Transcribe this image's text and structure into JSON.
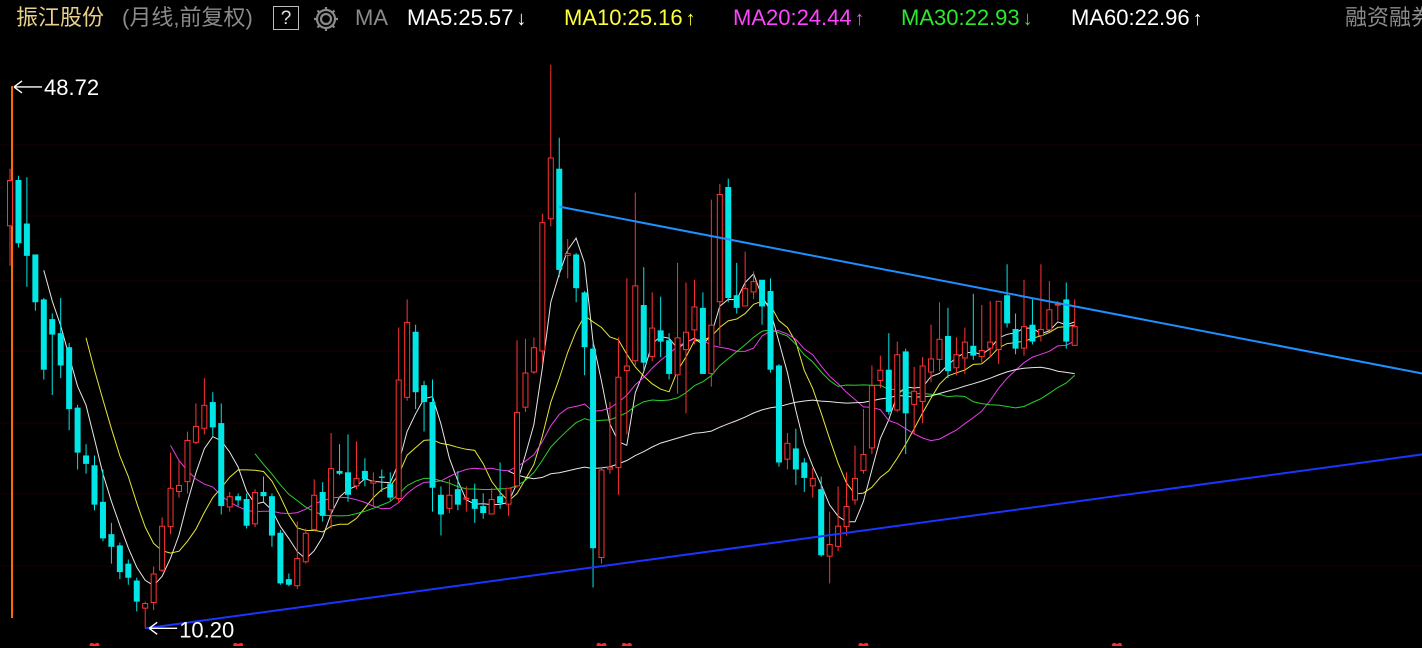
{
  "header": {
    "stock_name": "振江股份",
    "period": "(月线,前复权)",
    "help": "?",
    "settings_icon": "gear-icon",
    "ma_label": "MA",
    "indicators": [
      {
        "key": "ma5",
        "text": "MA5:25.57",
        "arrow": "↓",
        "color": "#ffffff"
      },
      {
        "key": "ma10",
        "text": "MA10:25.16",
        "arrow": "↑",
        "color": "#ffff3c"
      },
      {
        "key": "ma20",
        "text": "MA20:24.44",
        "arrow": "↑",
        "color": "#ff44ff"
      },
      {
        "key": "ma30",
        "text": "MA30:22.93",
        "arrow": "↓",
        "color": "#2ee82e"
      },
      {
        "key": "ma60",
        "text": "MA60:22.96",
        "arrow": "↑",
        "color": "#ffffff"
      }
    ],
    "right_label": "融资融券"
  },
  "chart_data": {
    "type": "candlestick",
    "ylim": [
      8.8,
      52.2
    ],
    "grid": true,
    "colors": {
      "up": "#ff3232",
      "down": "#00e5e5",
      "ma5": "#ffffff",
      "ma10": "#ffff3c",
      "ma20": "#ff44ff",
      "ma30": "#2ee82e",
      "ma60": "#ffffff",
      "trend_upper": "#1e90ff",
      "trend_lower": "#1c34ff"
    },
    "annotations": {
      "max": {
        "value": 48.72,
        "label": "48.72",
        "index": 0
      },
      "min": {
        "value": 10.2,
        "label": "10.20",
        "index": 16
      }
    },
    "candles": [
      [
        38.8,
        42.1,
        42.9,
        36.0
      ],
      [
        42.1,
        37.6,
        42.4,
        37.3
      ],
      [
        39.0,
        36.7,
        42.3,
        34.5
      ],
      [
        36.8,
        33.4,
        36.8,
        32.8
      ],
      [
        33.6,
        28.6,
        33.7,
        27.9
      ],
      [
        32.2,
        31.1,
        32.6,
        26.8
      ],
      [
        31.2,
        28.9,
        33.7,
        28.0
      ],
      [
        30.2,
        25.8,
        30.5,
        24.3
      ],
      [
        25.9,
        22.7,
        26.1,
        21.5
      ],
      [
        22.5,
        21.9,
        23.3,
        21.2
      ],
      [
        21.8,
        19.0,
        22.5,
        18.6
      ],
      [
        19.2,
        16.6,
        21.5,
        16.4
      ],
      [
        16.9,
        16.0,
        17.7,
        14.8
      ],
      [
        16.1,
        14.2,
        16.3,
        13.7
      ],
      [
        14.8,
        13.8,
        15.1,
        13.3
      ],
      [
        13.6,
        12.1,
        13.8,
        11.4
      ],
      [
        11.6,
        12.0,
        12.1,
        10.2
      ],
      [
        12.0,
        14.1,
        14.6,
        11.5
      ],
      [
        14.3,
        17.5,
        18.1,
        14.2
      ],
      [
        17.4,
        20.2,
        22.7,
        16.9
      ],
      [
        19.9,
        20.4,
        22.1,
        19.5
      ],
      [
        20.6,
        23.6,
        24.2,
        19.8
      ],
      [
        23.4,
        24.6,
        26.2,
        23.3
      ],
      [
        24.4,
        26.1,
        28.0,
        24.0
      ],
      [
        26.3,
        24.5,
        27.0,
        23.9
      ],
      [
        24.8,
        18.9,
        26.2,
        18.3
      ],
      [
        18.8,
        19.6,
        19.9,
        18.5
      ],
      [
        19.6,
        19.3,
        19.8,
        18.9
      ],
      [
        19.4,
        17.5,
        19.8,
        17.3
      ],
      [
        17.6,
        19.9,
        20.1,
        17.4
      ],
      [
        19.9,
        19.6,
        21.0,
        19.2
      ],
      [
        19.6,
        16.8,
        19.8,
        16.0
      ],
      [
        17.0,
        13.4,
        17.2,
        13.3
      ],
      [
        13.7,
        13.3,
        14.1,
        13.2
      ],
      [
        13.2,
        15.2,
        17.8,
        13.0
      ],
      [
        14.9,
        17.0,
        17.3,
        14.8
      ],
      [
        17.2,
        19.7,
        20.8,
        17.1
      ],
      [
        19.9,
        18.2,
        20.6,
        17.8
      ],
      [
        18.6,
        21.6,
        24.1,
        17.3
      ],
      [
        21.4,
        21.2,
        23.3,
        21.1
      ],
      [
        21.3,
        19.7,
        24.0,
        19.2
      ],
      [
        20.3,
        20.9,
        23.5,
        20.1
      ],
      [
        21.4,
        20.8,
        22.3,
        20.3
      ],
      [
        20.5,
        20.7,
        21.3,
        18.9
      ],
      [
        21.0,
        20.9,
        21.5,
        19.9
      ],
      [
        20.5,
        19.5,
        21.3,
        19.3
      ],
      [
        19.4,
        27.9,
        31.6,
        19.1
      ],
      [
        26.6,
        32.0,
        33.6,
        26.4
      ],
      [
        31.3,
        27.0,
        31.8,
        25.8
      ],
      [
        27.5,
        26.3,
        27.8,
        24.2
      ],
      [
        26.3,
        20.2,
        27.9,
        18.5
      ],
      [
        19.7,
        18.3,
        20.3,
        16.8
      ],
      [
        18.7,
        19.7,
        20.8,
        18.4
      ],
      [
        20.1,
        19.0,
        21.4,
        18.6
      ],
      [
        19.4,
        19.5,
        20.3,
        18.5
      ],
      [
        19.4,
        18.7,
        20.5,
        17.7
      ],
      [
        18.9,
        18.4,
        19.8,
        18.0
      ],
      [
        18.3,
        19.4,
        20.2,
        18.3
      ],
      [
        19.6,
        19.1,
        22.0,
        18.7
      ],
      [
        19.0,
        20.2,
        20.1,
        18.2
      ],
      [
        20.3,
        25.6,
        30.7,
        20.2
      ],
      [
        25.9,
        28.4,
        30.8,
        25.6
      ],
      [
        28.4,
        30.2,
        30.9,
        28.3
      ],
      [
        29.9,
        39.1,
        39.7,
        29.0
      ],
      [
        39.3,
        43.7,
        50.3,
        38.8
      ],
      [
        42.9,
        35.7,
        45.1,
        35.2
      ],
      [
        36.7,
        36.9,
        37.9,
        35.1
      ],
      [
        36.8,
        34.4,
        36.9,
        33.4
      ],
      [
        34.1,
        30.2,
        34.2,
        28.2
      ],
      [
        30.1,
        15.9,
        30.5,
        13.1
      ],
      [
        15.2,
        21.5,
        21.7,
        14.8
      ],
      [
        21.5,
        21.7,
        26.3,
        21.2
      ],
      [
        21.6,
        28.1,
        30.9,
        19.7
      ],
      [
        28.5,
        28.9,
        35.1,
        24.0
      ],
      [
        29.2,
        34.6,
        41.2,
        28.9
      ],
      [
        33.2,
        29.1,
        35.9,
        28.6
      ],
      [
        29.5,
        31.6,
        34.1,
        29.2
      ],
      [
        31.4,
        30.6,
        33.8,
        29.5
      ],
      [
        30.7,
        28.3,
        31.2,
        27.9
      ],
      [
        28.2,
        30.9,
        36.2,
        26.9
      ],
      [
        30.0,
        31.3,
        34.8,
        25.5
      ],
      [
        31.4,
        33.1,
        35.0,
        30.4
      ],
      [
        33.0,
        28.3,
        34.1,
        28.3
      ],
      [
        28.3,
        31.8,
        40.7,
        27.4
      ],
      [
        33.4,
        41.1,
        41.8,
        30.3
      ],
      [
        41.6,
        33.7,
        42.2,
        33.4
      ],
      [
        33.9,
        33.0,
        36.2,
        32.6
      ],
      [
        33.1,
        34.4,
        37.0,
        33.3
      ],
      [
        34.1,
        34.9,
        35.6,
        33.6
      ],
      [
        35.0,
        33.1,
        34.9,
        31.8
      ],
      [
        34.2,
        28.6,
        35.1,
        28.4
      ],
      [
        28.9,
        22.0,
        29.0,
        21.7
      ],
      [
        22.2,
        23.4,
        24.1,
        21.5
      ],
      [
        23.0,
        21.5,
        24.4,
        20.4
      ],
      [
        22.0,
        20.9,
        22.3,
        19.9
      ],
      [
        20.3,
        20.9,
        21.6,
        19.5
      ],
      [
        20.1,
        15.4,
        21.0,
        15.3
      ],
      [
        15.3,
        16.2,
        18.5,
        13.4
      ],
      [
        16.0,
        17.5,
        20.3,
        15.7
      ],
      [
        17.4,
        18.9,
        21.3,
        16.8
      ],
      [
        19.3,
        20.9,
        23.2,
        19.0
      ],
      [
        21.4,
        22.6,
        25.8,
        21.2
      ],
      [
        23.0,
        27.5,
        28.9,
        22.6
      ],
      [
        27.8,
        28.6,
        29.6,
        27.3
      ],
      [
        28.6,
        25.6,
        31.2,
        25.4
      ],
      [
        25.7,
        29.7,
        30.6,
        25.6
      ],
      [
        29.9,
        25.5,
        30.1,
        22.6
      ],
      [
        26.1,
        27.1,
        28.8,
        24.0
      ],
      [
        26.3,
        28.9,
        29.5,
        24.8
      ],
      [
        28.4,
        29.4,
        31.8,
        27.7
      ],
      [
        29.3,
        30.8,
        33.4,
        28.5
      ],
      [
        31.0,
        28.5,
        33.0,
        28.0
      ],
      [
        28.7,
        29.7,
        30.9,
        28.2
      ],
      [
        29.4,
        30.6,
        31.6,
        28.3
      ],
      [
        30.3,
        29.6,
        34.0,
        29.3
      ],
      [
        29.5,
        30.0,
        33.2,
        29.1
      ],
      [
        30.1,
        30.6,
        33.5,
        29.5
      ],
      [
        30.0,
        33.5,
        33.4,
        29.0
      ],
      [
        33.9,
        31.9,
        36.1,
        31.6
      ],
      [
        31.5,
        30.1,
        32.6,
        29.7
      ],
      [
        30.1,
        31.7,
        35.0,
        29.6
      ],
      [
        31.8,
        30.6,
        33.6,
        30.4
      ],
      [
        31.0,
        31.5,
        36.1,
        30.6
      ],
      [
        31.4,
        32.9,
        34.9,
        31.8
      ],
      [
        33.2,
        33.3,
        33.5,
        32.1
      ],
      [
        33.6,
        30.6,
        34.8,
        30.1
      ],
      [
        30.3,
        31.7,
        33.6,
        30.3
      ]
    ],
    "trendlines": [
      {
        "name": "upper",
        "from": [
          65,
          40.2
        ],
        "to": [
          176,
          27.3
        ]
      },
      {
        "name": "lower",
        "from": [
          16,
          10.2
        ],
        "to": [
          176,
          23.3
        ]
      }
    ]
  }
}
